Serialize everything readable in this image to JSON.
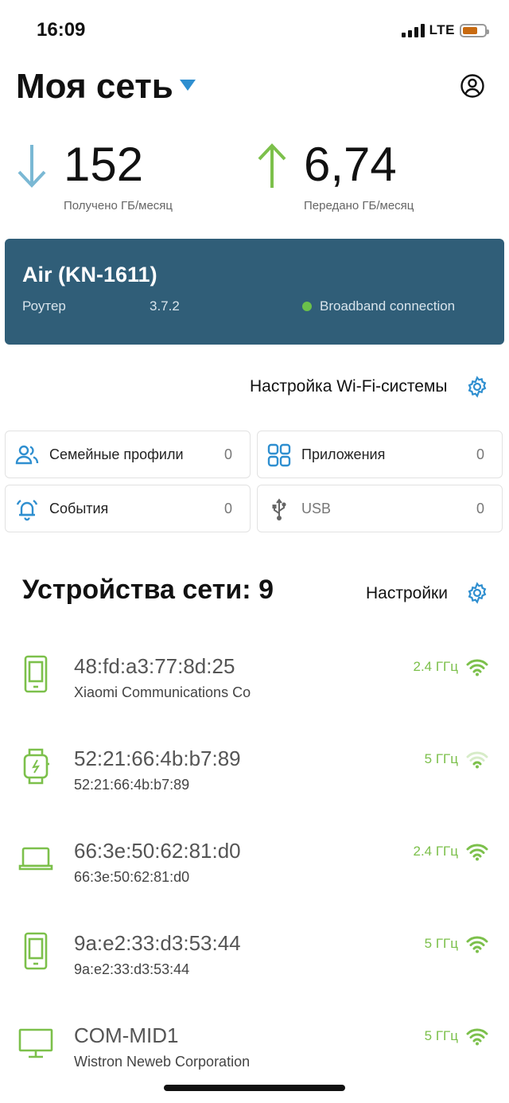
{
  "status_bar": {
    "time": "16:09",
    "network": "LTE"
  },
  "header": {
    "title": "Моя сеть"
  },
  "stats": {
    "received": {
      "value": "152",
      "caption": "Получено ГБ/месяц"
    },
    "sent": {
      "value": "6,74",
      "caption": "Передано ГБ/месяц"
    }
  },
  "router": {
    "name": "Air (KN-1611)",
    "type": "Роутер",
    "version": "3.7.2",
    "connection": "Broadband connection"
  },
  "wifi_setup": {
    "label": "Настройка Wi-Fi-системы"
  },
  "tiles": [
    {
      "label": "Семейные профили",
      "count": "0",
      "icon": "family-icon"
    },
    {
      "label": "Приложения",
      "count": "0",
      "icon": "apps-grid-icon"
    },
    {
      "label": "События",
      "count": "0",
      "icon": "alarm-bell-icon"
    },
    {
      "label": "USB",
      "count": "0",
      "icon": "usb-icon"
    }
  ],
  "devices": {
    "title": "Устройства сети: 9",
    "settings_label": "Настройки",
    "items": [
      {
        "name": "48:fd:a3:77:8d:25",
        "sub": "Xiaomi Communications Co",
        "band": "2.4 ГГц",
        "icon": "phone-icon",
        "signal": "strong"
      },
      {
        "name": "52:21:66:4b:b7:89",
        "sub": "52:21:66:4b:b7:89",
        "band": "5 ГГц",
        "icon": "smartwatch-icon",
        "signal": "weak"
      },
      {
        "name": "66:3e:50:62:81:d0",
        "sub": "66:3e:50:62:81:d0",
        "band": "2.4 ГГц",
        "icon": "laptop-icon",
        "signal": "strong"
      },
      {
        "name": "9a:e2:33:d3:53:44",
        "sub": "9a:e2:33:d3:53:44",
        "band": "5 ГГц",
        "icon": "phone-icon",
        "signal": "strong"
      },
      {
        "name": "COM-MID1",
        "sub": "Wistron Neweb Corporation",
        "band": "5 ГГц",
        "icon": "monitor-icon",
        "signal": "strong"
      }
    ]
  },
  "colors": {
    "accent": "#2f8fd0",
    "router_card": "#305e78",
    "green": "#7cc04b",
    "download_arrow": "#7ab8d4",
    "upload_arrow": "#7cc04b"
  }
}
